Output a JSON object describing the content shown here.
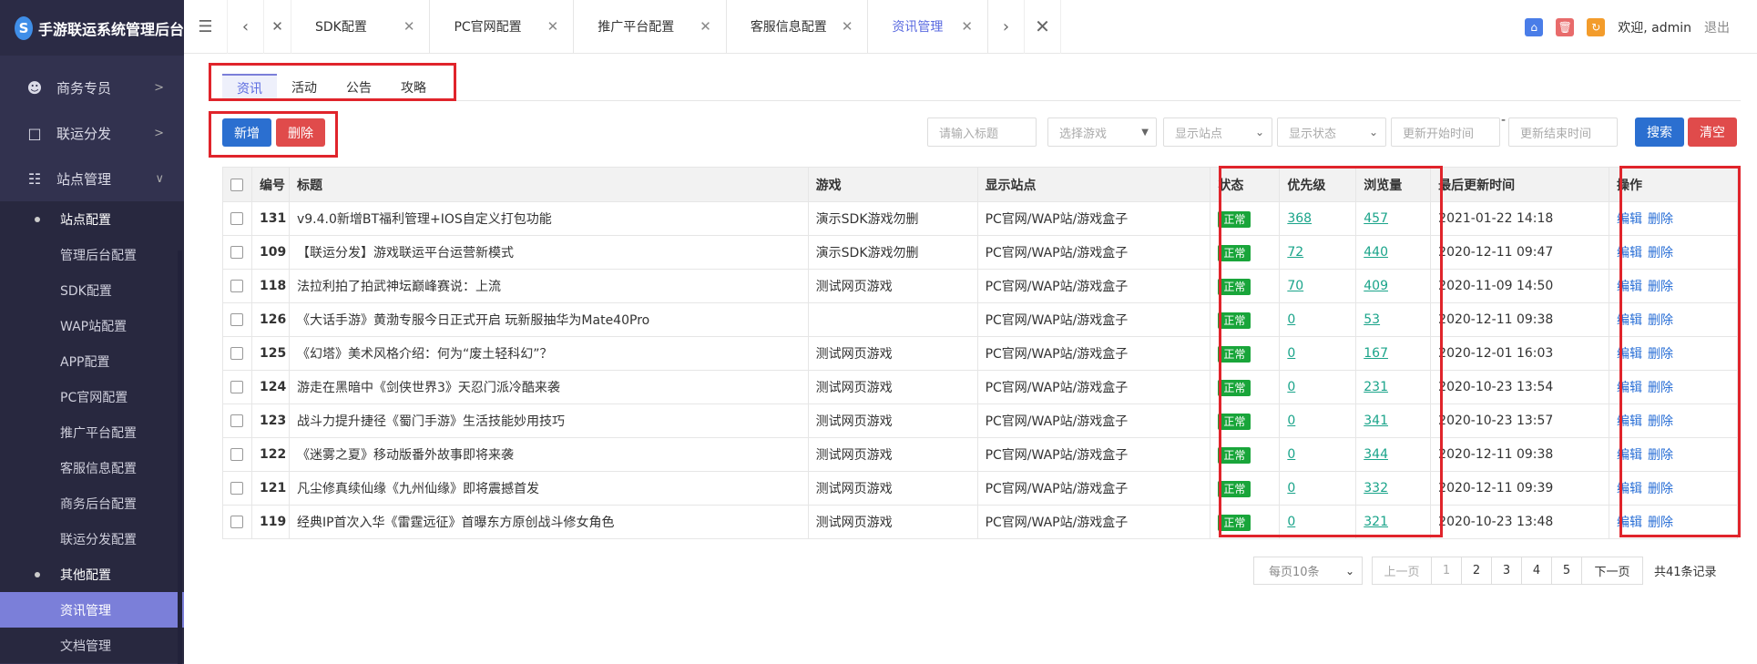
{
  "app": {
    "title": "手游联运系统管理后台",
    "logo_glyph": "S"
  },
  "sidebar": {
    "items": [
      {
        "label": "商务专员",
        "icon": "user-icon"
      },
      {
        "label": "联运分发",
        "icon": "share-icon"
      },
      {
        "label": "站点管理",
        "icon": "sitemap-icon"
      }
    ],
    "group1": "站点配置",
    "group1_items": [
      "管理后台配置",
      "SDK配置",
      "WAP站配置",
      "APP配置",
      "PC官网配置",
      "推广平台配置",
      "客服信息配置",
      "商务后台配置",
      "联运分发配置"
    ],
    "group2": "其他配置",
    "group2_items": [
      "资讯管理",
      "文档管理"
    ]
  },
  "topbar": {
    "tabs": [
      "SDK配置",
      "PC官网配置",
      "推广平台配置",
      "客服信息配置",
      "资讯管理"
    ],
    "welcome": "欢迎, admin",
    "logout": "退出"
  },
  "subtabs": [
    "资讯",
    "活动",
    "公告",
    "攻略"
  ],
  "toolbar": {
    "add": "新增",
    "delete": "删除"
  },
  "filters": {
    "title_placeholder": "请输入标题",
    "game": "选择游戏",
    "site": "显示站点",
    "status": "显示状态",
    "start": "更新开始时间",
    "end": "更新结束时间",
    "dash": "-",
    "search": "搜索",
    "clear": "清空"
  },
  "table": {
    "headers": [
      "编号",
      "标题",
      "游戏",
      "显示站点",
      "状态",
      "优先级",
      "浏览量",
      "最后更新时间",
      "操作"
    ],
    "rows": [
      {
        "id": "131",
        "title": "v9.4.0新增BT福利管理+IOS自定义打包功能",
        "game": "演示SDK游戏勿删",
        "site": "PC官网/WAP站/游戏盒子",
        "status": "正常",
        "priority": "368",
        "views": "457",
        "time": "2021-01-22 14:18"
      },
      {
        "id": "109",
        "title": "【联运分发】游戏联运平台运营新模式",
        "game": "演示SDK游戏勿删",
        "site": "PC官网/WAP站/游戏盒子",
        "status": "正常",
        "priority": "72",
        "views": "440",
        "time": "2020-12-11 09:47"
      },
      {
        "id": "118",
        "title": "法拉利拍了拍武神坛巅峰赛说：上流",
        "game": "测试网页游戏",
        "site": "PC官网/WAP站/游戏盒子",
        "status": "正常",
        "priority": "70",
        "views": "409",
        "time": "2020-11-09 14:50"
      },
      {
        "id": "126",
        "title": "《大话手游》黄渤专服今日正式开启 玩新服抽华为Mate40Pro",
        "game": "",
        "site": "PC官网/WAP站/游戏盒子",
        "status": "正常",
        "priority": "0",
        "views": "53",
        "time": "2020-12-11 09:38"
      },
      {
        "id": "125",
        "title": "《幻塔》美术风格介绍：何为“废土轻科幻”？",
        "game": "测试网页游戏",
        "site": "PC官网/WAP站/游戏盒子",
        "status": "正常",
        "priority": "0",
        "views": "167",
        "time": "2020-12-01 16:03"
      },
      {
        "id": "124",
        "title": "游走在黑暗中《剑侠世界3》天忍门派冷酷来袭",
        "game": "测试网页游戏",
        "site": "PC官网/WAP站/游戏盒子",
        "status": "正常",
        "priority": "0",
        "views": "231",
        "time": "2020-10-23 13:54"
      },
      {
        "id": "123",
        "title": "战斗力提升捷径《蜀门手游》生活技能妙用技巧",
        "game": "测试网页游戏",
        "site": "PC官网/WAP站/游戏盒子",
        "status": "正常",
        "priority": "0",
        "views": "341",
        "time": "2020-10-23 13:57"
      },
      {
        "id": "122",
        "title": "《迷雾之夏》移动版番外故事即将来袭",
        "game": "测试网页游戏",
        "site": "PC官网/WAP站/游戏盒子",
        "status": "正常",
        "priority": "0",
        "views": "344",
        "time": "2020-12-11 09:38"
      },
      {
        "id": "121",
        "title": "凡尘修真续仙缘《九州仙缘》即将震撼首发",
        "game": "测试网页游戏",
        "site": "PC官网/WAP站/游戏盒子",
        "status": "正常",
        "priority": "0",
        "views": "332",
        "time": "2020-12-11 09:39"
      },
      {
        "id": "119",
        "title": "经典IP首次入华《雷霆远征》首曝东方原创战斗修女角色",
        "game": "测试网页游戏",
        "site": "PC官网/WAP站/游戏盒子",
        "status": "正常",
        "priority": "0",
        "views": "321",
        "time": "2020-10-23 13:48"
      }
    ],
    "edit": "编辑",
    "del": "删除"
  },
  "pager": {
    "per_page": "每页10条",
    "prev": "上一页",
    "pages": [
      "1",
      "2",
      "3",
      "4",
      "5"
    ],
    "next": "下一页",
    "total": "共41条记录"
  }
}
